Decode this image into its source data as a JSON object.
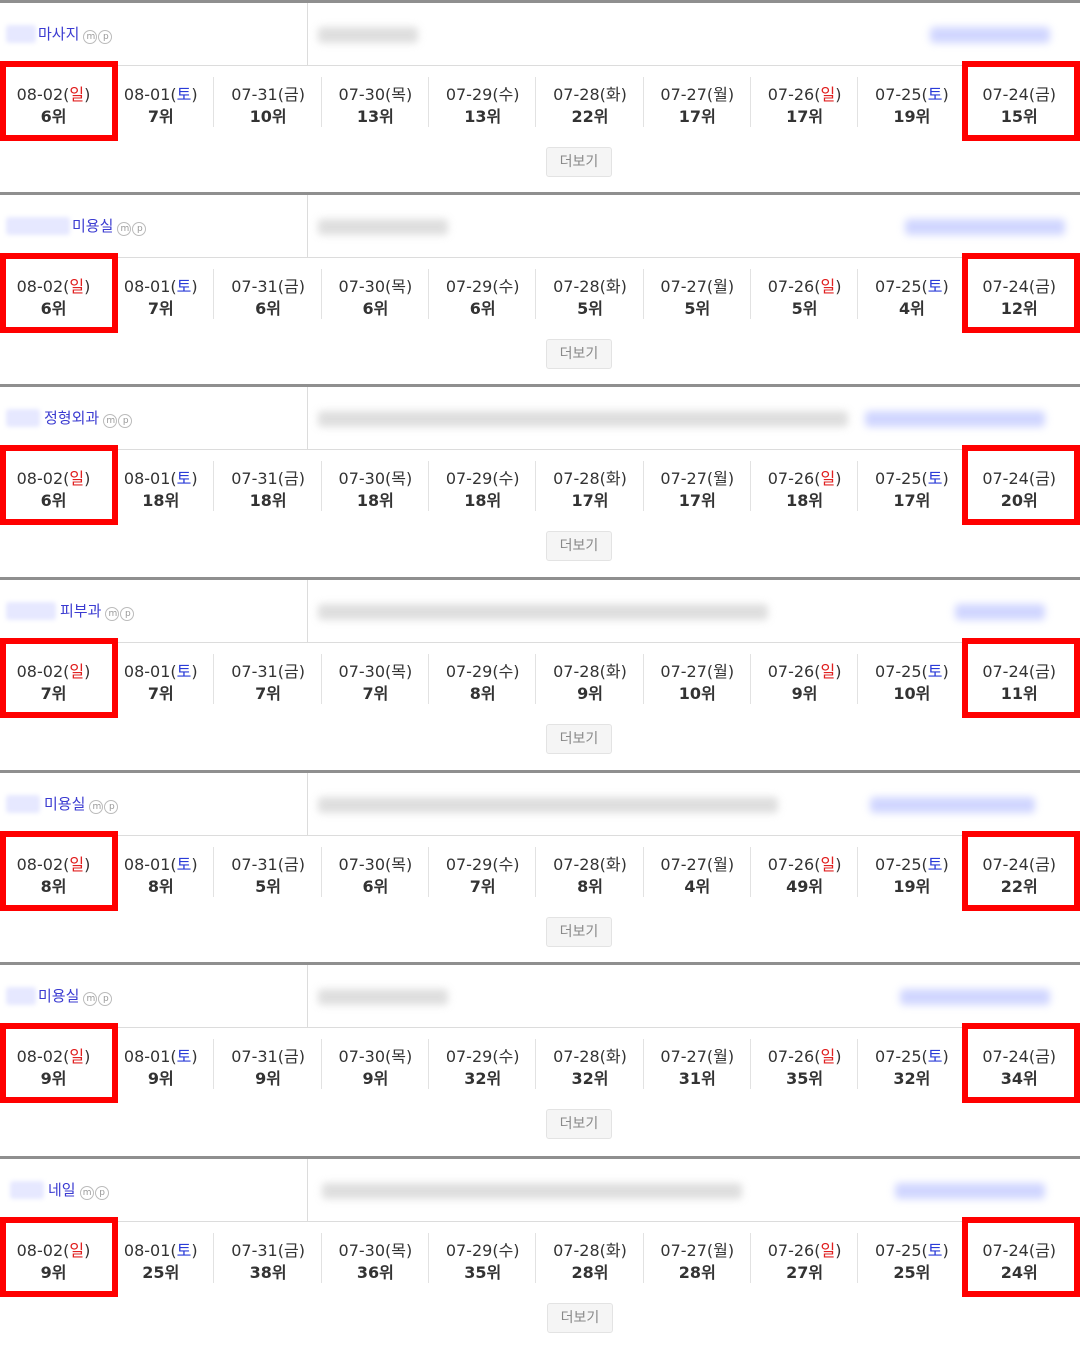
{
  "more_label": "더보기",
  "mp_labels": [
    "m",
    "p"
  ],
  "colors": {
    "highlight": "#ff0000",
    "sunday": "#e02020",
    "saturday": "#2a3bd8",
    "keyword": "#3b3bd1"
  },
  "dates": [
    {
      "md": "08-02",
      "dow": "일",
      "dow_type": "sun"
    },
    {
      "md": "08-01",
      "dow": "토",
      "dow_type": "sat"
    },
    {
      "md": "07-31",
      "dow": "금",
      "dow_type": "wk"
    },
    {
      "md": "07-30",
      "dow": "목",
      "dow_type": "wk"
    },
    {
      "md": "07-29",
      "dow": "수",
      "dow_type": "wk"
    },
    {
      "md": "07-28",
      "dow": "화",
      "dow_type": "wk"
    },
    {
      "md": "07-27",
      "dow": "월",
      "dow_type": "wk"
    },
    {
      "md": "07-26",
      "dow": "일",
      "dow_type": "sun"
    },
    {
      "md": "07-25",
      "dow": "토",
      "dow_type": "sat"
    },
    {
      "md": "07-24",
      "dow": "금",
      "dow_type": "wk"
    }
  ],
  "cards": [
    {
      "keyword": "마사지",
      "ranks": [
        "6위",
        "7위",
        "10위",
        "13위",
        "13위",
        "22위",
        "17위",
        "17위",
        "19위",
        "15위"
      ]
    },
    {
      "keyword": "미용실",
      "ranks": [
        "6위",
        "7위",
        "6위",
        "6위",
        "6위",
        "5위",
        "5위",
        "5위",
        "4위",
        "12위"
      ]
    },
    {
      "keyword": "정형외과",
      "ranks": [
        "6위",
        "18위",
        "18위",
        "18위",
        "18위",
        "17위",
        "17위",
        "18위",
        "17위",
        "20위"
      ]
    },
    {
      "keyword": "피부과",
      "ranks": [
        "7위",
        "7위",
        "7위",
        "7위",
        "8위",
        "9위",
        "10위",
        "9위",
        "10위",
        "11위"
      ]
    },
    {
      "keyword": "미용실",
      "ranks": [
        "8위",
        "8위",
        "5위",
        "6위",
        "7위",
        "8위",
        "4위",
        "49위",
        "19위",
        "22위"
      ]
    },
    {
      "keyword": "미용실",
      "ranks": [
        "9위",
        "9위",
        "9위",
        "9위",
        "32위",
        "32위",
        "31위",
        "35위",
        "32위",
        "34위"
      ]
    },
    {
      "keyword": "네일",
      "ranks": [
        "9위",
        "25위",
        "38위",
        "36위",
        "35위",
        "28위",
        "28위",
        "27위",
        "25위",
        "24위"
      ]
    }
  ]
}
